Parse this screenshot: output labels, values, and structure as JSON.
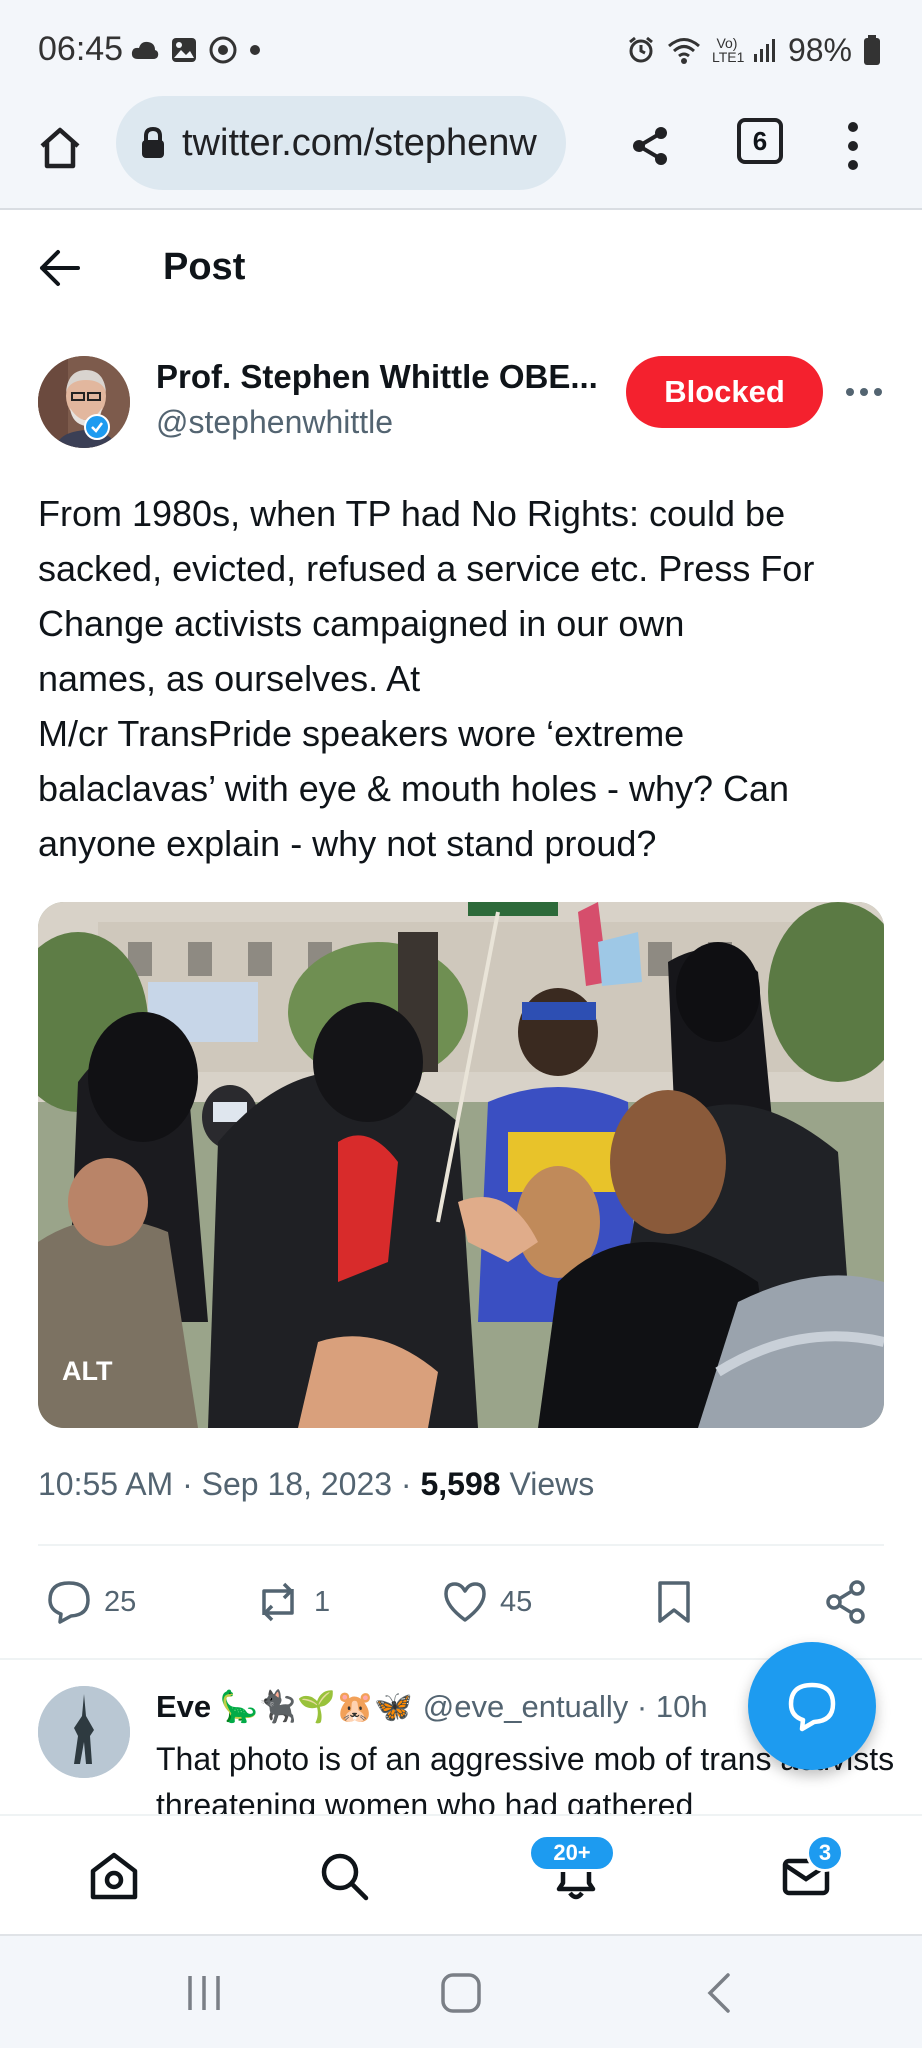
{
  "status_bar": {
    "time": "06:45",
    "battery": "98%",
    "network": "Vo) LTE1"
  },
  "browser": {
    "url": "twitter.com/stephenw",
    "tab_count": "6"
  },
  "header": {
    "title": "Post"
  },
  "author": {
    "name": "Prof. Stephen Whittle OBE...",
    "handle": "@stephenwhittle",
    "relation_button": "Blocked"
  },
  "tweet": {
    "text": "From 1980s, when TP had No Rights: could be\nsacked, evicted, refused a service etc. Press For\nChange activists campaigned in our own\nnames, as ourselves. At\nM/cr TransPride speakers wore  ‘extreme\nbalaclavas’ with eye & mouth holes - why? Can\nanyone explain - why not stand proud?",
    "alt_badge": "ALT",
    "timestamp": "10:55 AM · Sep 18, 2023 · ",
    "views_count": "5,598",
    "views_label": " Views"
  },
  "actions": {
    "replies": "25",
    "reposts": "1",
    "likes": "45"
  },
  "reply": {
    "name": "Eve 🦕🐈‍⬛🌱🐹🦋",
    "meta": "@eve_entually · 10h",
    "text": "That photo is of an aggressive mob of trans activists threatening women who had gathered"
  },
  "bottom_nav": {
    "notifications_badge": "20+",
    "messages_badge": "3"
  },
  "colors": {
    "accent": "#1d9bf0",
    "blocked": "#f4212e",
    "secondary_text": "#536471"
  }
}
